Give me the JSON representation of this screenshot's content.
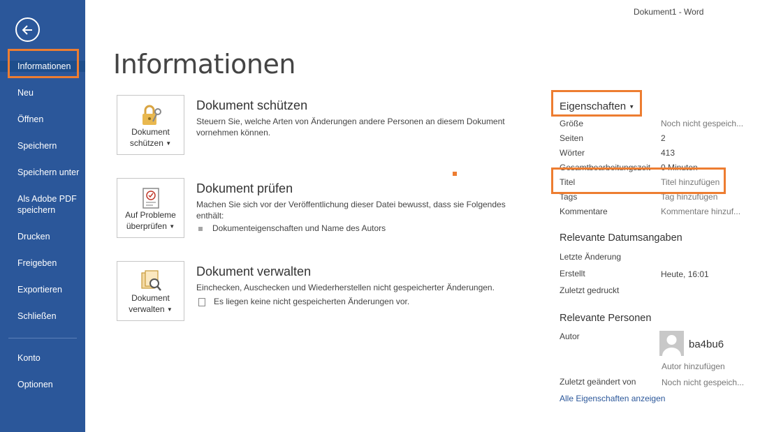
{
  "window": {
    "title": "Dokument1 - Word"
  },
  "page": {
    "title": "Informationen"
  },
  "sidebar": {
    "items": [
      {
        "label": "Informationen"
      },
      {
        "label": "Neu"
      },
      {
        "label": "Öffnen"
      },
      {
        "label": "Speichern"
      },
      {
        "label": "Speichern unter"
      },
      {
        "label": "Als Adobe PDF speichern"
      },
      {
        "label": "Drucken"
      },
      {
        "label": "Freigeben"
      },
      {
        "label": "Exportieren"
      },
      {
        "label": "Schließen"
      },
      {
        "label": "Konto"
      },
      {
        "label": "Optionen"
      }
    ],
    "active": "Informationen"
  },
  "actions": {
    "protect": {
      "button_line1": "Dokument",
      "button_line2": "schützen",
      "title": "Dokument schützen",
      "text": "Steuern Sie, welche Arten von Änderungen andere Personen an diesem Dokument vornehmen können."
    },
    "inspect": {
      "button_line1": "Auf Probleme",
      "button_line2": "überprüfen",
      "title": "Dokument prüfen",
      "text": "Machen Sie sich vor der Veröffentlichung dieser Datei bewusst, dass sie Folgendes enthält:",
      "bullet": "Dokumenteigenschaften und Name des Autors"
    },
    "manage": {
      "button_line1": "Dokument",
      "button_line2": "verwalten",
      "title": "Dokument verwalten",
      "text": "Einchecken, Auschecken und Wiederherstellen nicht gespeicherter Änderungen.",
      "note": "Es liegen keine nicht gespeicherten Änderungen vor."
    }
  },
  "properties": {
    "header": "Eigenschaften",
    "rows": [
      {
        "key": "Größe",
        "value": "Noch nicht gespeich..."
      },
      {
        "key": "Seiten",
        "value": "2"
      },
      {
        "key": "Wörter",
        "value": "413"
      },
      {
        "key": "Gesamtbearbeitungszeit",
        "value": "0 Minuten"
      },
      {
        "key": "Titel",
        "value": "Titel hinzufügen"
      },
      {
        "key": "Tags",
        "value": "Tag hinzufügen"
      },
      {
        "key": "Kommentare",
        "value": "Kommentare hinzuf..."
      }
    ]
  },
  "dates": {
    "title": "Relevante Datumsangaben",
    "rows": [
      {
        "key": "Letzte Änderung",
        "value": ""
      },
      {
        "key": "Erstellt",
        "value": "Heute, 16:01"
      },
      {
        "key": "Zuletzt gedruckt",
        "value": ""
      }
    ]
  },
  "people": {
    "title": "Relevante Personen",
    "author_key": "Autor",
    "author_name": "ba4bu6",
    "add_author": "Autor hinzufügen",
    "last_modified_key": "Zuletzt geändert von",
    "last_modified_value": "Noch nicht gespeich..."
  },
  "links": {
    "all_properties": "Alle Eigenschaften anzeigen"
  },
  "colors": {
    "sidebar": "#2b579a",
    "highlight": "#ed7d31"
  }
}
